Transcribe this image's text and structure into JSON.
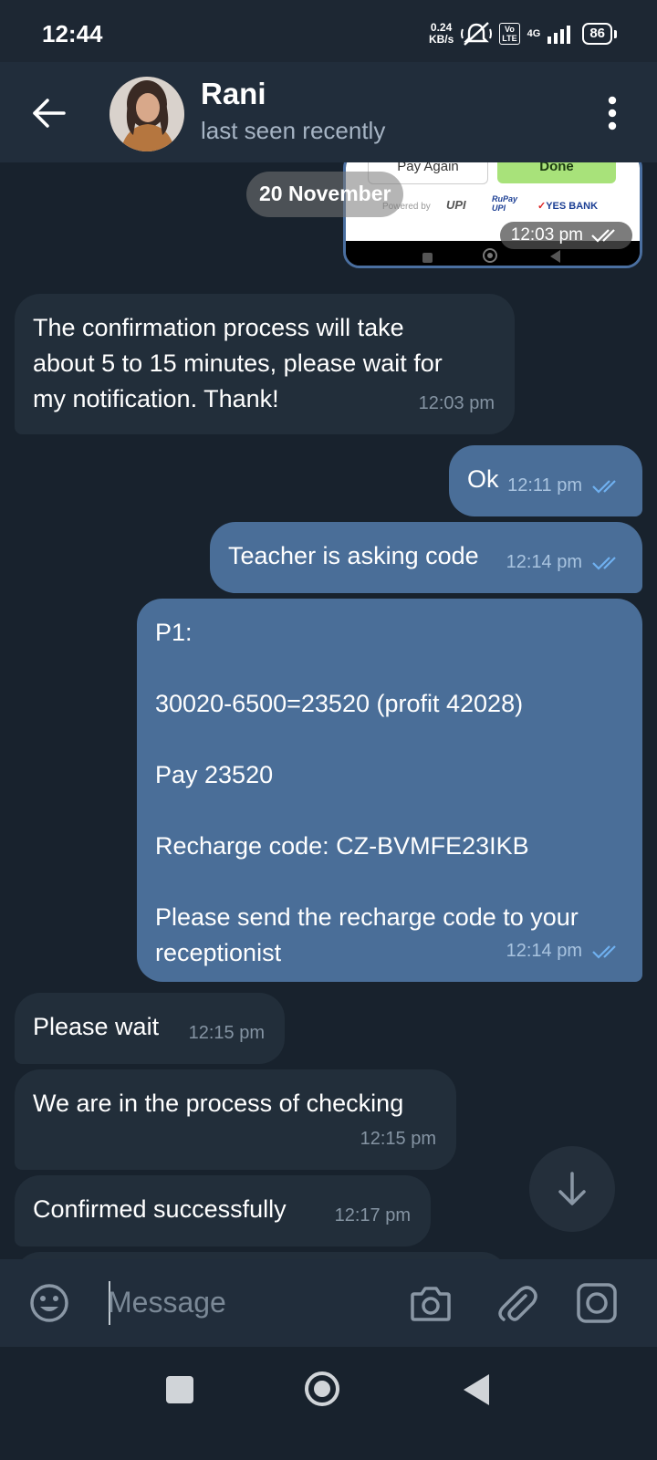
{
  "status_bar": {
    "time": "12:44",
    "net_speed_value": "0.24",
    "net_speed_unit": "KB/s",
    "volte_top": "Vo",
    "volte_bottom": "LTE",
    "network": "4G",
    "battery": "86"
  },
  "header": {
    "name": "Rani",
    "status": "last seen recently"
  },
  "image_preview": {
    "pay_again": "Pay Again",
    "done": "Done",
    "powered_by": "Powered by",
    "upi": "UPI",
    "rupay_top": "RuPay",
    "rupay_bottom": "UPI",
    "bank": "YES BANK",
    "time": "12:03 pm"
  },
  "date_divider": "20 November",
  "messages": [
    {
      "dir": "in",
      "text": "The confirmation process will take\nabout 5 to 15 minutes, please wait for\nmy notification. Thank!",
      "time": "12:03 pm"
    },
    {
      "dir": "out",
      "text": "Ok",
      "time": "12:11 pm",
      "read": true
    },
    {
      "dir": "out",
      "text": "Teacher is asking code",
      "time": "12:14 pm",
      "read": true
    },
    {
      "dir": "out",
      "text": "P1:\n\n30020-6500=23520 (profit 42028)\n\nPay 23520\n\nRecharge code: CZ-BVMFE23IKB\n\nPlease send the recharge code to your\nreceptionist",
      "time": "12:14 pm",
      "read": true
    },
    {
      "dir": "in",
      "text": "Please wait",
      "time": "12:15 pm"
    },
    {
      "dir": "in",
      "text": "We are in the process of checking",
      "time": "12:15 pm"
    },
    {
      "dir": "in",
      "text": "Confirmed successfully",
      "time": "12:17 pm"
    }
  ],
  "input": {
    "placeholder": "Message"
  },
  "colors": {
    "background": "#18222d",
    "header": "#212d3b",
    "incoming_bubble": "#222e3a",
    "outgoing_bubble": "#4a6e98",
    "read_check": "#6fb0f0"
  },
  "icons": [
    "back-arrow-icon",
    "menu-dots-icon",
    "double-check-icon",
    "arrow-down-icon",
    "emoji-icon",
    "camera-icon",
    "attach-icon",
    "video-message-icon"
  ]
}
